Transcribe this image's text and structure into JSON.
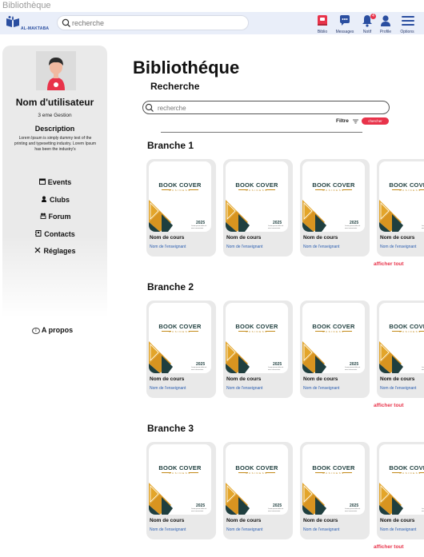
{
  "page_label": "Bibliothèque",
  "navbar": {
    "logo_text": "AL-MAKTABA",
    "search_placeholder": "recherche",
    "items": [
      {
        "label": "Biblio",
        "icon": "book-icon"
      },
      {
        "label": "Messages",
        "icon": "chat-icon"
      },
      {
        "label": "Notif",
        "icon": "bell-icon",
        "badge": "4"
      },
      {
        "label": "Profile",
        "icon": "user-icon"
      },
      {
        "label": "Options",
        "icon": "menu-icon"
      }
    ]
  },
  "sidebar": {
    "avatar_badge": "admin",
    "user_name": "Nom d'utilisateur",
    "user_class": "3 eme Gestion",
    "description_title": "Description",
    "description_text": "Lorem Ipsum is simply dummy text of the printing and typesetting industry. Lorem Ipsum has been the industry's",
    "menu": [
      {
        "label": "Events",
        "icon": "calendar-icon"
      },
      {
        "label": "Clubs",
        "icon": "clubs-icon"
      },
      {
        "label": "Forum",
        "icon": "forum-icon"
      },
      {
        "label": "Contacts",
        "icon": "contacts-icon"
      },
      {
        "label": "Réglages",
        "icon": "settings-icon"
      }
    ],
    "about_label": "A propos"
  },
  "main": {
    "title": "Bibliothéque",
    "search_title": "Recherche",
    "search_placeholder": "recherche",
    "filter_label": "Filtre",
    "search_button": "chercher",
    "show_all_label": "afficher tout",
    "cover": {
      "title": "BOOK COVER",
      "subtitle": "BUSINESS",
      "year": "2025",
      "tiny_text": "Lorem ipsum dolor sit amet consectetur"
    },
    "branches": [
      {
        "title": "Branche 1",
        "courses": [
          {
            "name": "Nom de cours",
            "teacher": "Nom de l'enseignant"
          },
          {
            "name": "Nom de cours",
            "teacher": "Nom de l'enseignant"
          },
          {
            "name": "Nom de cours",
            "teacher": "Nom de l'enseignant"
          },
          {
            "name": "Nom de cours",
            "teacher": "Nom de l'enseignant"
          }
        ]
      },
      {
        "title": "Branche 2",
        "courses": [
          {
            "name": "Nom de cours",
            "teacher": "Nom de l'enseignant"
          },
          {
            "name": "Nom de cours",
            "teacher": "Nom de l'enseignant"
          },
          {
            "name": "Nom de cours",
            "teacher": "Nom de l'enseignant"
          },
          {
            "name": "Nom de cours",
            "teacher": "Nom de l'enseignant"
          }
        ]
      },
      {
        "title": "Branche 3",
        "courses": [
          {
            "name": "Nom de cours",
            "teacher": "Nom de l'enseignant"
          },
          {
            "name": "Nom de cours",
            "teacher": "Nom de l'enseignant"
          },
          {
            "name": "Nom de cours",
            "teacher": "Nom de l'enseignant"
          },
          {
            "name": "Nom de cours",
            "teacher": "Nom de l'enseignant"
          }
        ]
      }
    ]
  },
  "colors": {
    "accent": "#e8334a",
    "navbar_bg": "#e9eef9",
    "sidebar_bg": "#eaeaea",
    "card_bg": "#e9e9e9",
    "link_blue": "#2a5db0",
    "cover_green": "#1f3f3f",
    "cover_gold": "#e3a52a"
  }
}
